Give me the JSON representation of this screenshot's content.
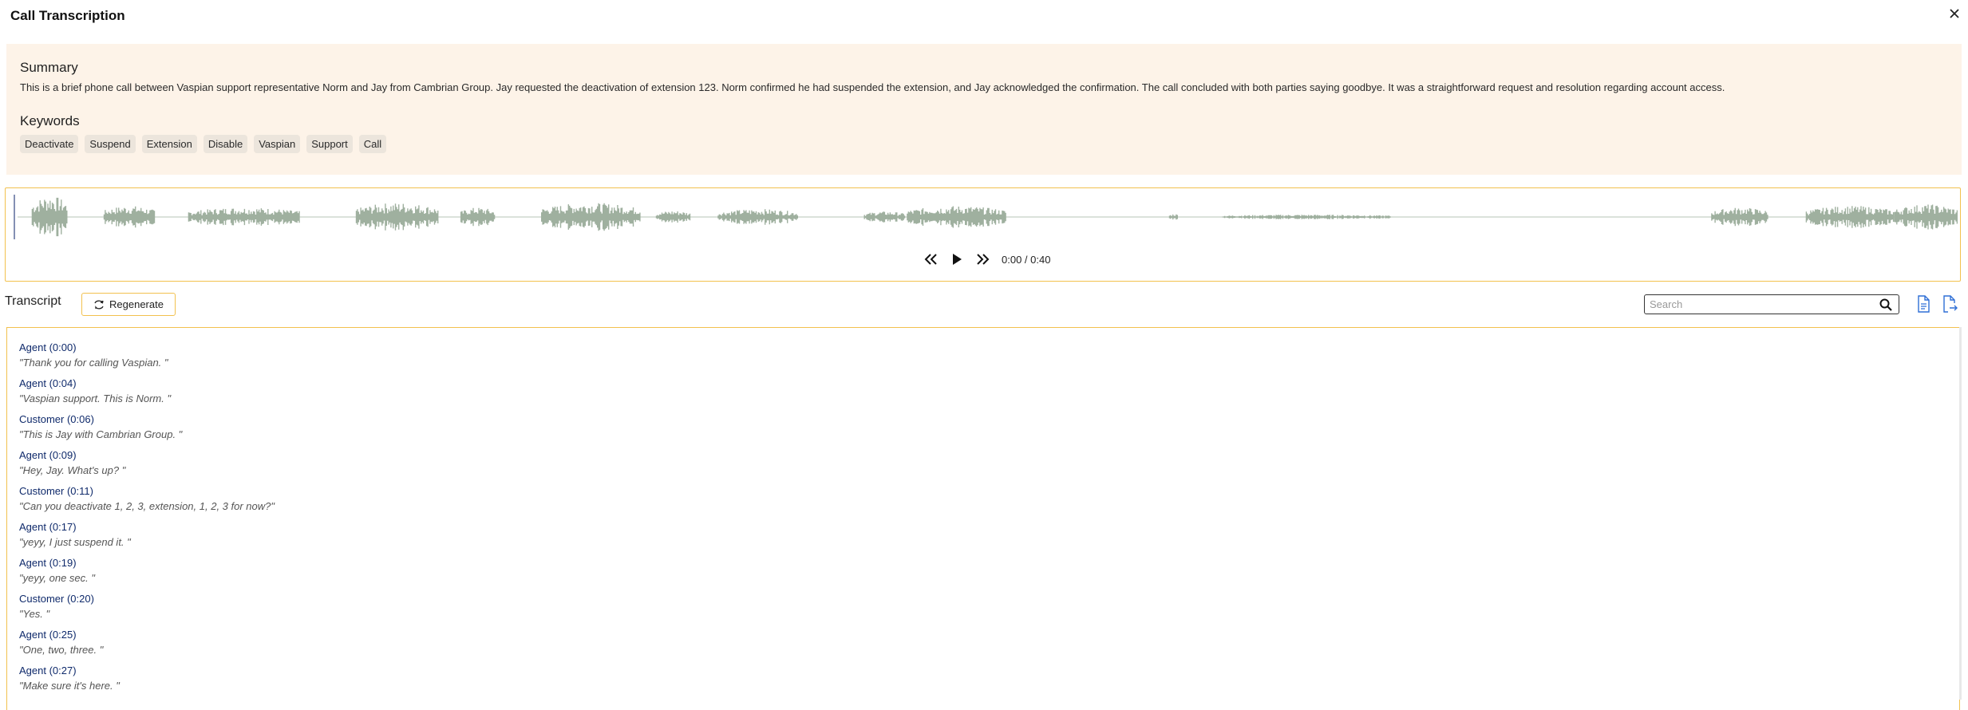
{
  "window": {
    "title": "Call Transcription"
  },
  "summary": {
    "heading": "Summary",
    "text": "This is a brief phone call between Vaspian support representative Norm and Jay from Cambrian Group. Jay requested the deactivation of extension 123. Norm confirmed he had suspended the extension, and Jay acknowledged the confirmation. The call concluded with both parties saying goodbye. It was a straightforward request and resolution regarding account access."
  },
  "keywords": {
    "heading": "Keywords",
    "items": [
      "Deactivate",
      "Suspend",
      "Extension",
      "Disable",
      "Vaspian",
      "Support",
      "Call"
    ]
  },
  "player": {
    "time": "0:00 / 0:40",
    "played_fraction": 0,
    "waveform_color": "#9fb09f"
  },
  "transcript": {
    "title": "Transcript",
    "regenerate_label": "Regenerate",
    "search_placeholder": "Search",
    "entries": [
      {
        "speaker": "Agent (0:00)",
        "text": "\"Thank you for calling Vaspian. \""
      },
      {
        "speaker": "Agent (0:04)",
        "text": "\"Vaspian support. This is Norm. \""
      },
      {
        "speaker": "Customer (0:06)",
        "text": "\"This is Jay with Cambrian Group. \""
      },
      {
        "speaker": "Agent (0:09)",
        "text": "\"Hey, Jay. What's up? \""
      },
      {
        "speaker": "Customer (0:11)",
        "text": "\"Can you deactivate 1, 2, 3, extension, 1, 2, 3 for now?\""
      },
      {
        "speaker": "Agent (0:17)",
        "text": "\"yeyy, I just suspend it. \""
      },
      {
        "speaker": "Agent (0:19)",
        "text": "\"yeyy, one sec. \""
      },
      {
        "speaker": "Customer (0:20)",
        "text": "\"Yes. \""
      },
      {
        "speaker": "Agent (0:25)",
        "text": "\"One, two, three. \""
      },
      {
        "speaker": "Agent (0:27)",
        "text": "\"Make sure it's here. \""
      }
    ]
  },
  "colors": {
    "accent_border": "#f2c14e",
    "summary_bg": "#fdf3e8",
    "speaker_text": "#0f2a6b"
  },
  "icons": {
    "close": "close-icon",
    "rewind": "rewind-icon",
    "play": "play-icon",
    "forward": "fast-forward-icon",
    "regenerate": "refresh-icon",
    "search": "search-icon",
    "document": "document-icon",
    "export": "export-icon"
  }
}
